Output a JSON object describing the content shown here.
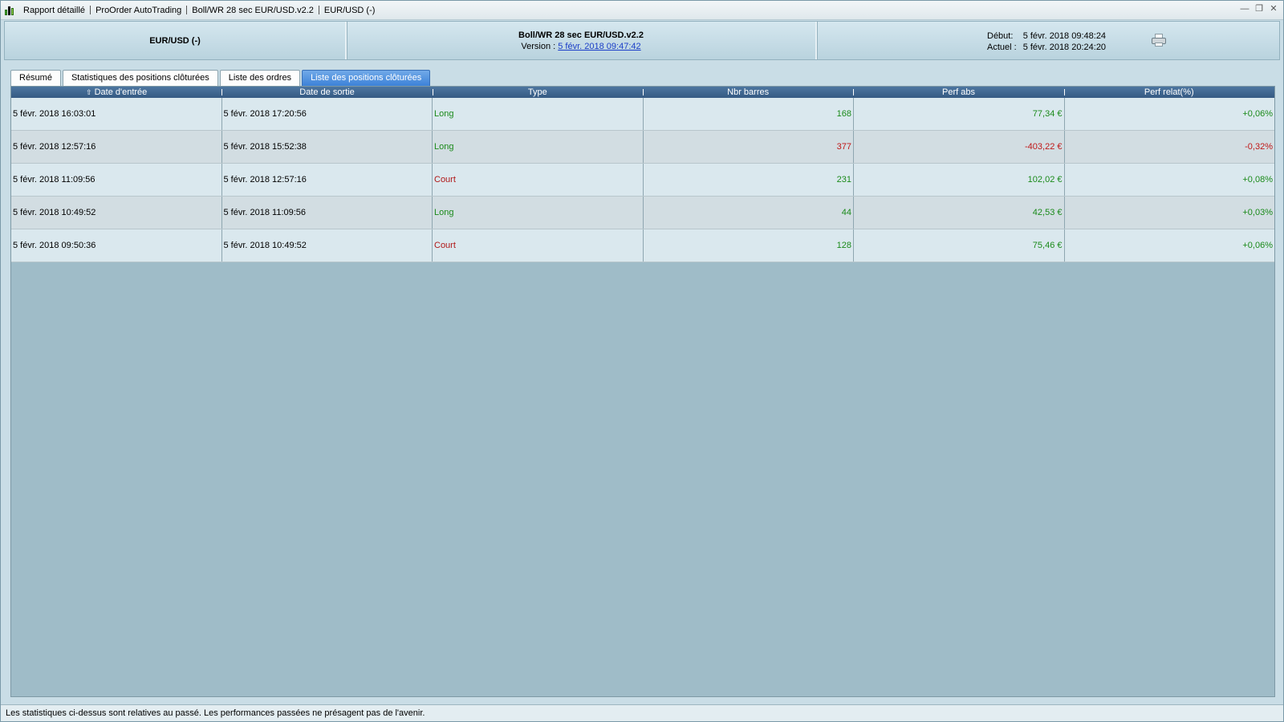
{
  "titlebar": {
    "items": [
      "Rapport détaillé",
      "ProOrder AutoTrading",
      "Boll/WR 28 sec EUR/USD.v2.2",
      "EUR/USD (-)"
    ]
  },
  "header": {
    "instrument": "EUR/USD (-)",
    "strategy_name": "Boll/WR 28 sec EUR/USD.v2.2",
    "version_label": "Version :",
    "version_link": "5 févr. 2018 09:47:42",
    "start_label": "Début:",
    "start_value": "5 févr. 2018 09:48:24",
    "current_label": "Actuel :",
    "current_value": "5 févr. 2018 20:24:20"
  },
  "tabs": [
    {
      "label": "Résumé",
      "active": false
    },
    {
      "label": "Statistiques des positions clôturées",
      "active": false
    },
    {
      "label": "Liste des ordres",
      "active": false
    },
    {
      "label": "Liste des positions clôturées",
      "active": true
    }
  ],
  "table": {
    "columns": [
      "Date d'entrée",
      "Date de sortie",
      "Type",
      "Nbr barres",
      "Perf abs",
      "Perf relat(%)"
    ],
    "rows": [
      {
        "entry": "5 févr. 2018 16:03:01",
        "exit": "5 févr. 2018 17:20:56",
        "type": "Long",
        "bars": "168",
        "perf_abs": "77,34 €",
        "perf_rel": "+0,06%",
        "sign": "pos"
      },
      {
        "entry": "5 févr. 2018 12:57:16",
        "exit": "5 févr. 2018 15:52:38",
        "type": "Long",
        "bars": "377",
        "perf_abs": "-403,22 €",
        "perf_rel": "-0,32%",
        "sign": "neg"
      },
      {
        "entry": "5 févr. 2018 11:09:56",
        "exit": "5 févr. 2018 12:57:16",
        "type": "Court",
        "bars": "231",
        "perf_abs": "102,02 €",
        "perf_rel": "+0,08%",
        "sign": "pos"
      },
      {
        "entry": "5 févr. 2018 10:49:52",
        "exit": "5 févr. 2018 11:09:56",
        "type": "Long",
        "bars": "44",
        "perf_abs": "42,53 €",
        "perf_rel": "+0,03%",
        "sign": "pos"
      },
      {
        "entry": "5 févr. 2018 09:50:36",
        "exit": "5 févr. 2018 10:49:52",
        "type": "Court",
        "bars": "128",
        "perf_abs": "75,46 €",
        "perf_rel": "+0,06%",
        "sign": "pos"
      }
    ]
  },
  "status": {
    "text": "Les statistiques ci-dessus sont relatives au passé. Les performances passées ne présagent pas de l'avenir."
  },
  "icons": {
    "app": "chart-candles-icon",
    "print": "printer-icon",
    "sort": "sort-up-icon"
  },
  "colors": {
    "positive": "#1a8a1a",
    "negative": "#c01818",
    "active_tab": "#3c82d8",
    "table_header": "#355a83"
  }
}
